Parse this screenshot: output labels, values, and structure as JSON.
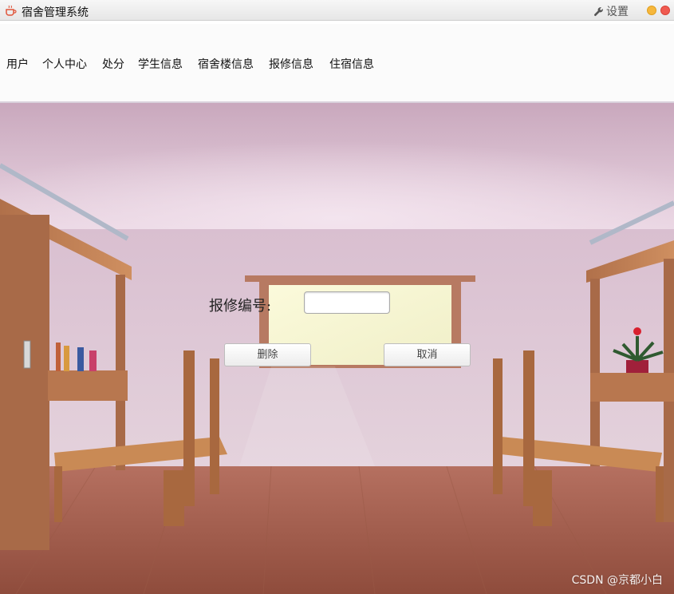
{
  "window": {
    "title": "宿舍管理系统",
    "settings_label": "设置"
  },
  "menu": {
    "items": [
      "用户",
      "个人中心",
      "处分",
      "学生信息",
      "宿舍楼信息",
      "报修信息",
      "住宿信息"
    ]
  },
  "form": {
    "field_label": "报修编号:",
    "field_value": "",
    "delete_label": "删除",
    "cancel_label": "取消"
  },
  "watermark": "CSDN @京都小白",
  "colors": {
    "close": "#f05a50",
    "minimize": "#f6b73c",
    "wall": "#dcc3d2",
    "floor": "#a86048"
  }
}
